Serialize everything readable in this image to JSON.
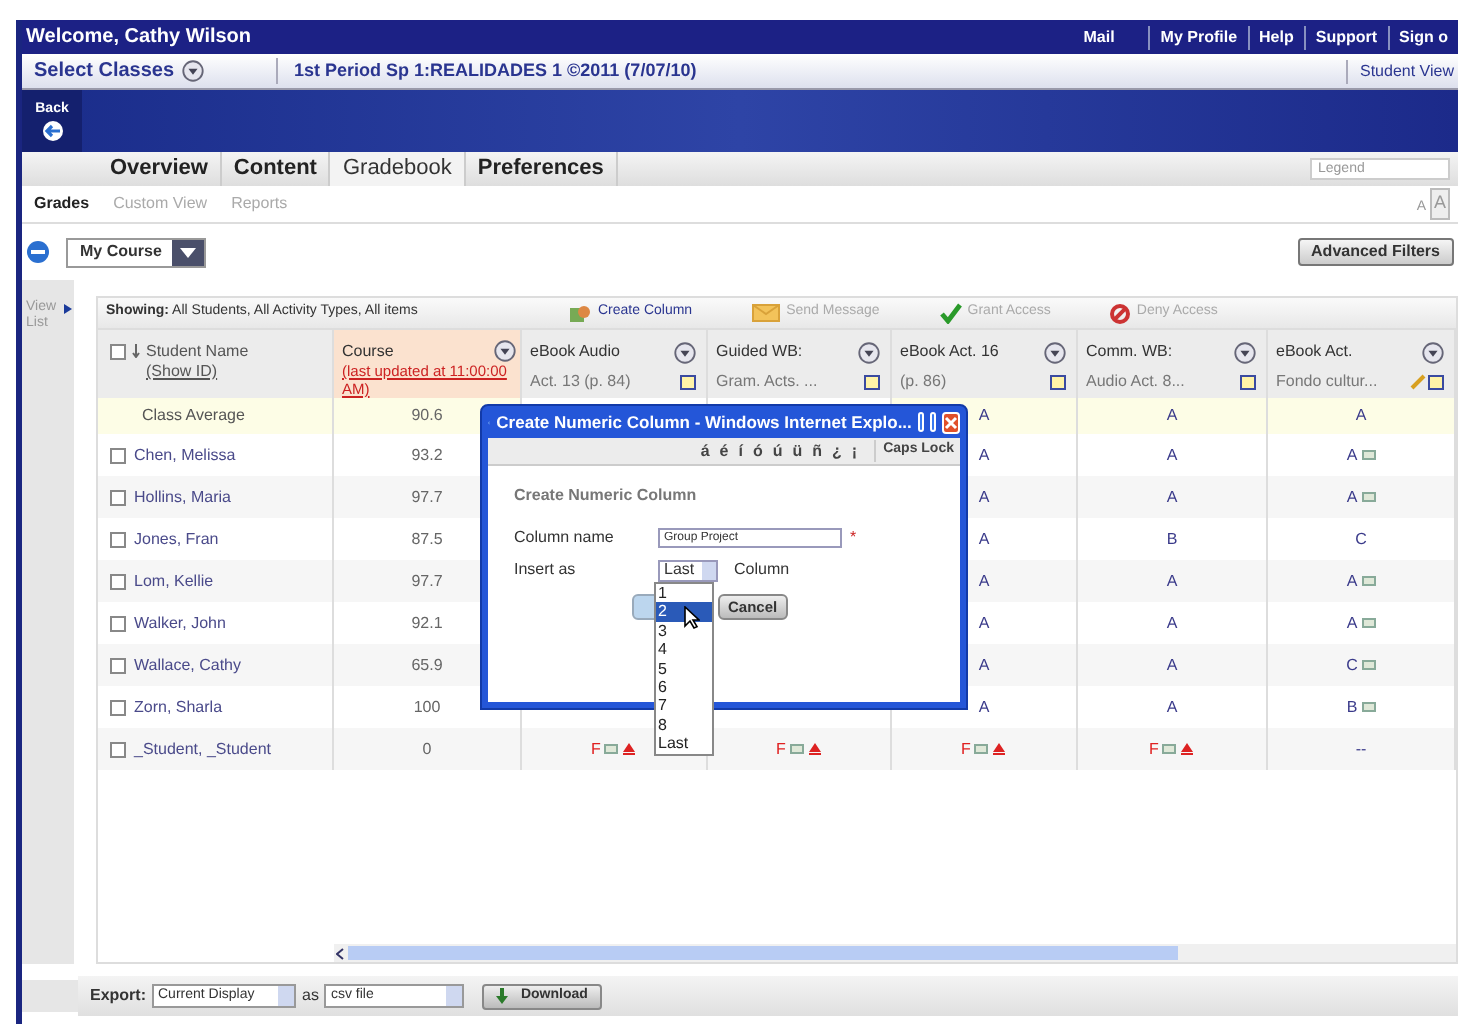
{
  "top_bar": {
    "welcome": "Welcome, Cathy Wilson",
    "links": [
      "Mail",
      "My Profile",
      "Help",
      "Support",
      "Sign o"
    ]
  },
  "class_bar": {
    "select_label": "Select Classes",
    "class_name": "1st Period Sp 1:REALIDADES 1 ©2011 (7/07/10)",
    "student_view": "Student View"
  },
  "back_button": "Back",
  "tabs": [
    {
      "label": "Overview",
      "selected": false
    },
    {
      "label": "Content",
      "selected": false
    },
    {
      "label": "Gradebook",
      "selected": true
    },
    {
      "label": "Preferences",
      "selected": false
    }
  ],
  "legend": {
    "placeholder": "Legend"
  },
  "subnav": [
    {
      "label": "Grades",
      "selected": true
    },
    {
      "label": "Custom View",
      "selected": false
    },
    {
      "label": "Reports",
      "selected": false
    }
  ],
  "font_size_buttons": [
    "A",
    "A"
  ],
  "course_select": "My Course",
  "advanced_filters": "Advanced Filters",
  "view_list": "View List",
  "toolbar": {
    "showing": "**Showing:** All Students, All Activity Types, All items",
    "actions": [
      {
        "label": "Create Column",
        "kind": "create",
        "disabled": false
      },
      {
        "label": "Send Message",
        "kind": "message",
        "disabled": true
      },
      {
        "label": "Grant Access",
        "kind": "grant",
        "disabled": true
      },
      {
        "label": "Deny Access",
        "kind": "deny",
        "disabled": true
      }
    ]
  },
  "name_header": {
    "title": "Student Name",
    "link": "(Show ID)",
    "checked": false
  },
  "course_header": {
    "title": "Course",
    "note": "(last updated at 11:00:00 AM)"
  },
  "columns": [
    {
      "title": "eBook Audio",
      "subtitle": "Act. 13 (p. 84)",
      "edit": false
    },
    {
      "title": "Guided WB:",
      "subtitle": "Gram. Acts. ...",
      "edit": false
    },
    {
      "title": "eBook Act. 16",
      "subtitle": "(p. 86)",
      "edit": false
    },
    {
      "title": "Comm. WB:",
      "subtitle": "Audio Act. 8...",
      "edit": false
    },
    {
      "title": "eBook Act.",
      "subtitle": "Fondo cultur...",
      "edit": true
    }
  ],
  "rows": [
    {
      "kind": "average",
      "name": "Class Average",
      "course": "90.6",
      "grades": [
        {
          "text": "A",
          "failing": false,
          "comment": false,
          "alert": false
        },
        {
          "text": "A",
          "failing": false,
          "comment": false,
          "alert": false
        },
        {
          "text": "A",
          "failing": false,
          "comment": false,
          "alert": false
        }
      ]
    },
    {
      "kind": "student",
      "name": "Chen, Melissa",
      "checked": false,
      "course": "93.2",
      "grades": [
        {
          "text": "A",
          "failing": false,
          "comment": false,
          "alert": false
        },
        {
          "text": "A",
          "failing": false,
          "comment": false,
          "alert": false
        },
        {
          "text": "A",
          "failing": false,
          "comment": true,
          "alert": false
        }
      ]
    },
    {
      "kind": "student",
      "name": "Hollins, Maria",
      "checked": false,
      "course": "97.7",
      "grades": [
        {
          "text": "A",
          "failing": false,
          "comment": false,
          "alert": false
        },
        {
          "text": "A",
          "failing": false,
          "comment": false,
          "alert": false
        },
        {
          "text": "A",
          "failing": false,
          "comment": true,
          "alert": false
        }
      ]
    },
    {
      "kind": "student",
      "name": "Jones, Fran",
      "checked": false,
      "course": "87.5",
      "grades": [
        {
          "text": "A",
          "failing": false,
          "comment": false,
          "alert": false
        },
        {
          "text": "B",
          "failing": false,
          "comment": false,
          "alert": false
        },
        {
          "text": "C",
          "failing": false,
          "comment": false,
          "alert": false
        }
      ]
    },
    {
      "kind": "student",
      "name": "Lom, Kellie",
      "checked": false,
      "course": "97.7",
      "grades": [
        {
          "text": "A",
          "failing": false,
          "comment": false,
          "alert": false
        },
        {
          "text": "A",
          "failing": false,
          "comment": false,
          "alert": false
        },
        {
          "text": "A",
          "failing": false,
          "comment": true,
          "alert": false
        }
      ]
    },
    {
      "kind": "student",
      "name": "Walker, John",
      "checked": false,
      "course": "92.1",
      "grades": [
        {
          "text": "A",
          "failing": false,
          "comment": false,
          "alert": false
        },
        {
          "text": "A",
          "failing": false,
          "comment": false,
          "alert": false
        },
        {
          "text": "A",
          "failing": false,
          "comment": true,
          "alert": false
        }
      ]
    },
    {
      "kind": "student",
      "name": "Wallace, Cathy",
      "checked": false,
      "course": "65.9",
      "grades": [
        {
          "text": "A",
          "failing": false,
          "comment": false,
          "alert": false
        },
        {
          "text": "A",
          "failing": false,
          "comment": false,
          "alert": false
        },
        {
          "text": "C",
          "failing": false,
          "comment": true,
          "alert": false
        }
      ]
    },
    {
      "kind": "student",
      "name": "Zorn, Sharla",
      "checked": false,
      "course": "100",
      "grades": [
        {
          "text": "A",
          "failing": false,
          "comment": false,
          "alert": false
        },
        {
          "text": "A",
          "failing": false,
          "comment": false,
          "alert": false
        },
        {
          "text": "B",
          "failing": false,
          "comment": true,
          "alert": false
        }
      ]
    },
    {
      "kind": "student",
      "name": "_Student, _Student",
      "checked": false,
      "course": "0",
      "grades": [
        {
          "text": "F",
          "failing": true,
          "comment": true,
          "alert": true
        },
        {
          "text": "F",
          "failing": true,
          "comment": true,
          "alert": true
        },
        {
          "text": "F",
          "failing": true,
          "comment": true,
          "alert": true
        },
        {
          "text": "F",
          "failing": true,
          "comment": true,
          "alert": true
        },
        {
          "text": "--",
          "failing": false,
          "comment": false,
          "alert": false
        }
      ]
    }
  ],
  "export": {
    "label": "Export:",
    "display": "Current Display",
    "as": "as",
    "format": "csv file",
    "download": "Download"
  },
  "dialog": {
    "title": "Create Numeric Column - Windows Internet Explo...",
    "chars": [
      "á",
      "é",
      "í",
      "ó",
      "ú",
      "ü",
      "ñ",
      "¿",
      "¡"
    ],
    "caps_lock": "Caps Lock",
    "heading": "Create Numeric Column",
    "name_label": "Column name",
    "name_value": "Group Project",
    "required": "*",
    "insert_label": "Insert as",
    "insert_value": "Last",
    "insert_suffix": "Column",
    "cancel": "Cancel",
    "options": [
      {
        "label": "1",
        "selected": false
      },
      {
        "label": "2",
        "selected": true
      },
      {
        "label": "3",
        "selected": false
      },
      {
        "label": "4",
        "selected": false
      },
      {
        "label": "5",
        "selected": false
      },
      {
        "label": "6",
        "selected": false
      },
      {
        "label": "7",
        "selected": false
      },
      {
        "label": "8",
        "selected": false
      },
      {
        "label": "Last",
        "selected": false
      }
    ]
  }
}
